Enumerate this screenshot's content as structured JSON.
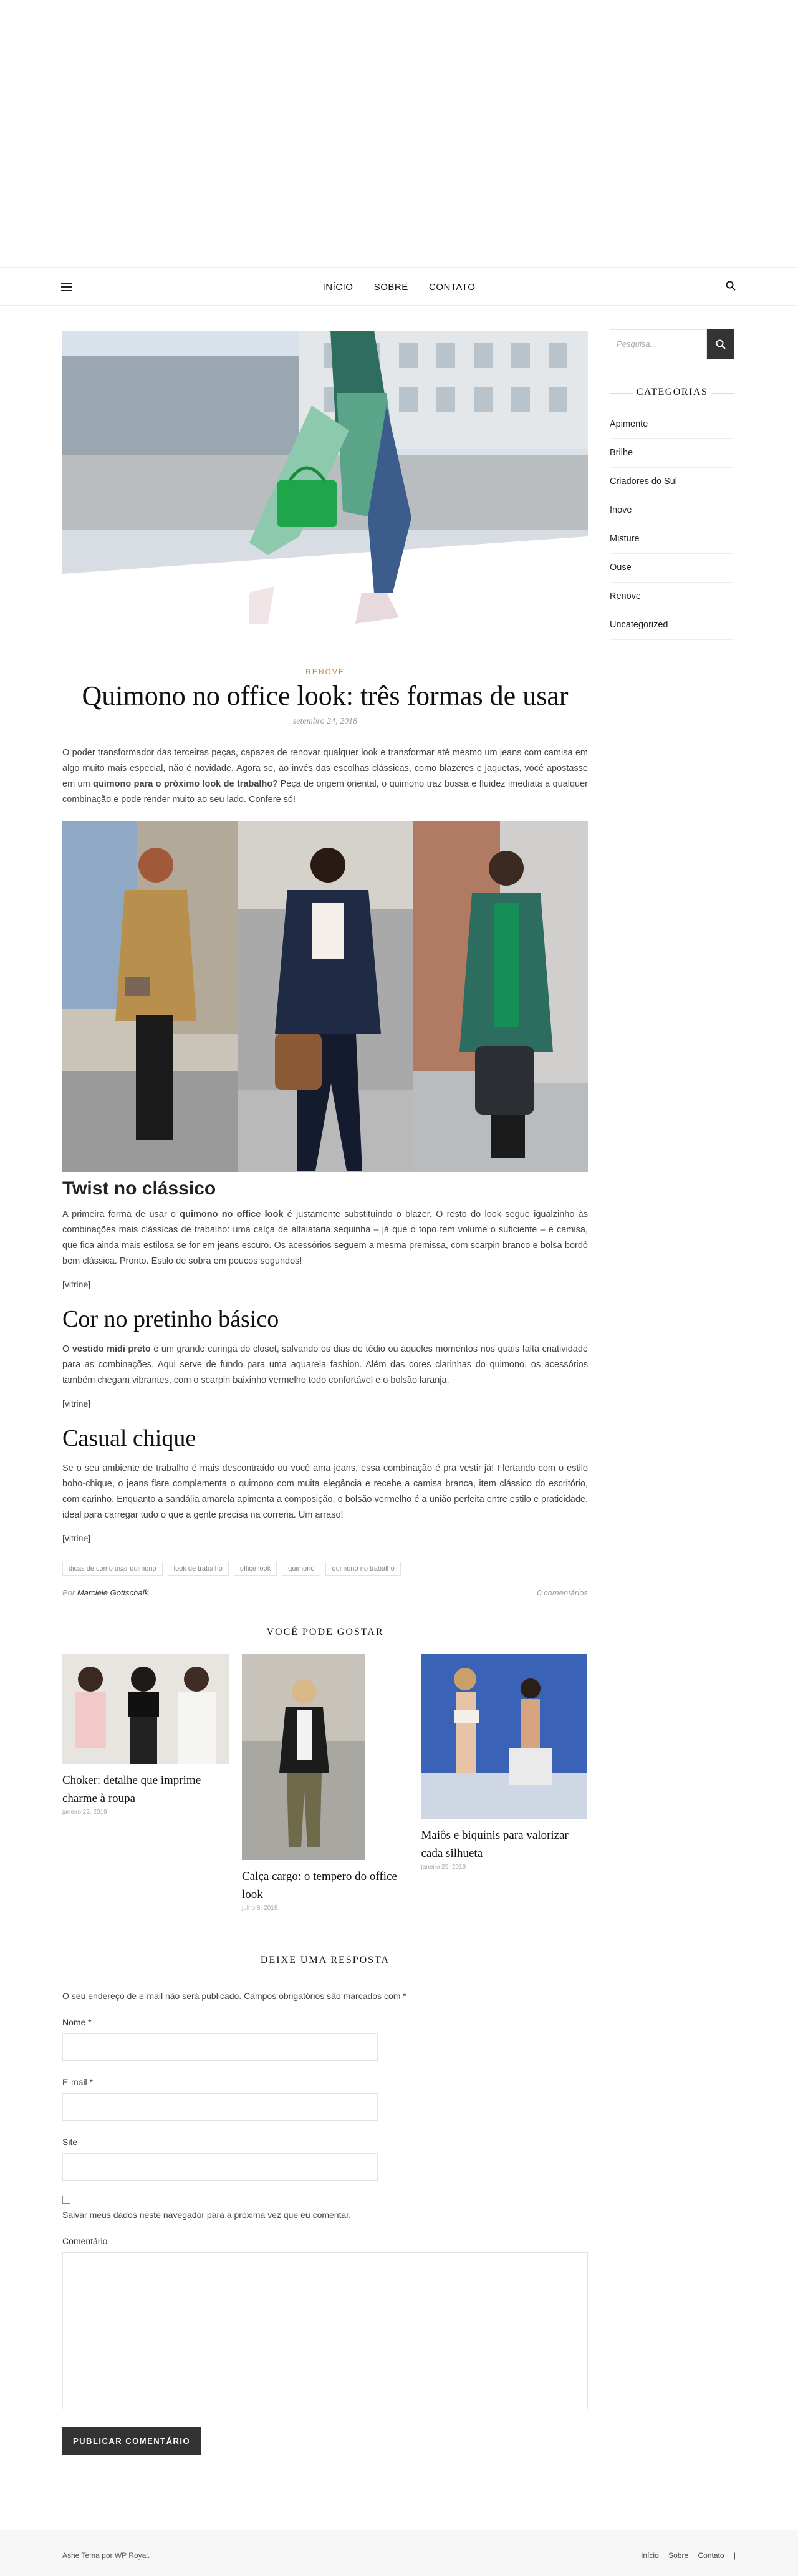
{
  "nav": {
    "menu": [
      "INÍCIO",
      "SOBRE",
      "CONTATO"
    ]
  },
  "sidebar": {
    "search_placeholder": "Pesquisa...",
    "categories_title": "CATEGORIAS",
    "categories": [
      "Apimente",
      "Brilhe",
      "Criadores do Sul",
      "Inove",
      "Misture",
      "Ouse",
      "Renove",
      "Uncategorized"
    ]
  },
  "post": {
    "category": "RENOVE",
    "title": "Quimono no office look: três formas de usar",
    "date": "setembro 24, 2018",
    "intro_a": "O poder transformador das terceiras peças, capazes de renovar qualquer look e transformar até mesmo um jeans com camisa em algo muito mais especial, não é novidade. Agora se, ao invés das escolhas clássicas, como blazeres e jaquetas, você apostasse em um ",
    "intro_bold": "quimono para o próximo look de trabalho",
    "intro_b": "? Peça de origem oriental, o quimono traz bossa e fluidez imediata a qualquer combinação e pode render muito ao seu lado. Confere só!",
    "s1_title": "Twist no clássico",
    "s1_a": "A primeira forma de usar o ",
    "s1_bold": "quimono no office look",
    "s1_b": " é justamente substituindo o blazer. O resto do look segue igualzinho às combinações mais clássicas de trabalho: uma calça de alfaiataria sequinha – já que o topo tem volume o suficiente – e camisa, que fica ainda mais estilosa se for em jeans escuro. Os acessórios seguem a mesma premissa, com scarpin branco e bolsa bordô bem clássica. Pronto. Estilo de sobra em poucos segundos!",
    "vitrine": "[vitrine]",
    "s2_title": "Cor no pretinho básico",
    "s2_a": "O ",
    "s2_bold": "vestido midi preto",
    "s2_b": " é um grande curinga do closet, salvando os dias de tédio ou aqueles momentos nos quais falta criatividade para as combinações. Aqui serve de fundo para uma aquarela fashion. Além das cores clarinhas do quimono, os acessórios também chegam vibrantes, com o scarpin baixinho vermelho todo confortável e o bolsão laranja.",
    "s3_title": "Casual chique",
    "s3_text": "Se o seu ambiente de trabalho é mais descontraído ou você ama jeans, essa combinação é pra vestir já! Flertando com o estilo boho-chique, o jeans flare complementa o quimono com muita elegância e recebe a camisa branca, item clássico do escritório, com carinho. Enquanto a sandália amarela apimenta a composição, o bolsão vermelho é a união perfeita entre estilo e praticidade, ideal para carregar tudo o que a gente precisa na correria. Um arraso!",
    "tags": [
      "dicas de como usar quimono",
      "look de trabalho",
      "office look",
      "quimono",
      "quimono no trabalho"
    ],
    "author_prefix": "Por ",
    "author": "Marciele Gottschalk",
    "comments": "0 comentários"
  },
  "related": {
    "title": "VOCÊ PODE GOSTAR",
    "items": [
      {
        "title": "Choker: detalhe que imprime charme à roupa",
        "date": "janeiro 22, 2019"
      },
      {
        "title": "Calça cargo: o tempero do office look",
        "date": "julho 8, 2019"
      },
      {
        "title": "Maiôs e biquínis para valorizar cada silhueta",
        "date": "janeiro 25, 2019"
      }
    ]
  },
  "comment_form": {
    "title": "DEIXE UMA RESPOSTA",
    "note": "O seu endereço de e-mail não será publicado. Campos obrigatórios são marcados com *",
    "name_label": "Nome *",
    "email_label": "E-mail *",
    "site_label": "Site",
    "save_label": "Salvar meus dados neste navegador para a próxima vez que eu comentar.",
    "comment_label": "Comentário",
    "submit": "PUBLICAR COMENTÁRIO"
  },
  "footer": {
    "credit": "Ashe Tema por WP Royal.",
    "links": [
      "Início",
      "Sobre",
      "Contato",
      "|"
    ]
  }
}
